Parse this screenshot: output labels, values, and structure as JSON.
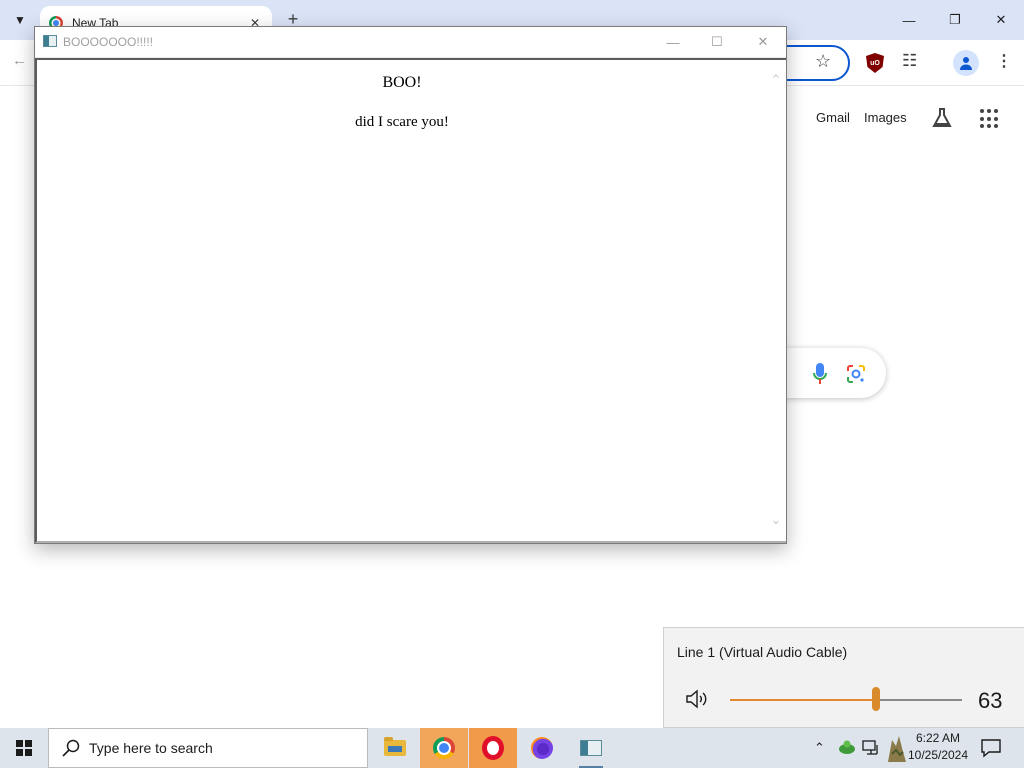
{
  "browser": {
    "tab": {
      "title": "New Tab"
    },
    "links": {
      "gmail": "Gmail",
      "images": "Images"
    }
  },
  "popup_window": {
    "title": "BOOOOOOO!!!!!",
    "heading": "BOO!",
    "message": "did I scare you!"
  },
  "volume_flyout": {
    "device": "Line 1 (Virtual Audio Cable)",
    "volume": 63,
    "volume_display": "63",
    "accent_color": "#e3892f"
  },
  "taskbar": {
    "search_placeholder": "Type here to search",
    "apps": [
      "file-explorer",
      "chrome",
      "opera",
      "firefox",
      "boo-app"
    ],
    "clock": {
      "time": "6:22 AM",
      "date": "10/25/2024"
    }
  }
}
